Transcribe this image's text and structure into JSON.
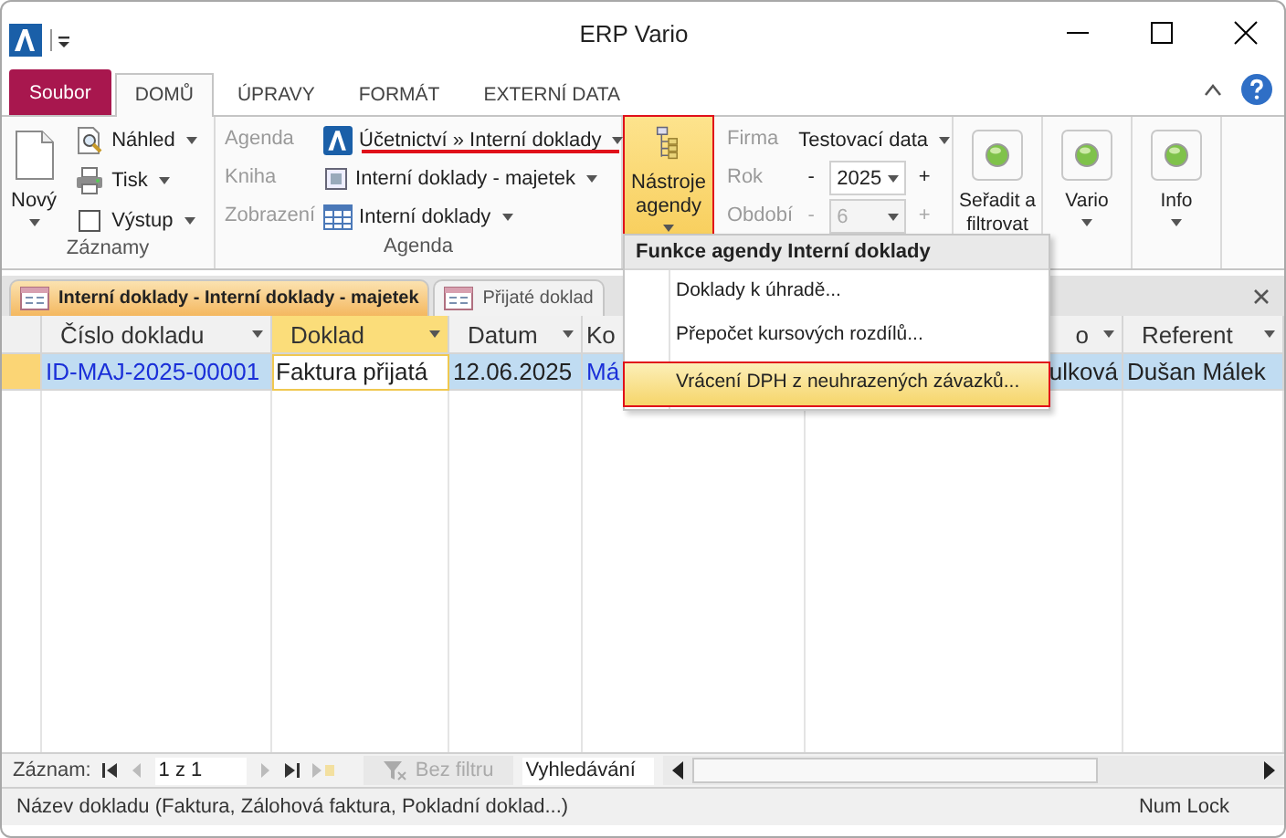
{
  "window": {
    "title": "ERP Vario"
  },
  "ribbon_tabs": [
    {
      "label": "Soubor",
      "kind": "file",
      "selected": false
    },
    {
      "label": "DOMŮ",
      "kind": "tab",
      "selected": true
    },
    {
      "label": "ÚPRAVY",
      "kind": "tab",
      "selected": false
    },
    {
      "label": "FORMÁT",
      "kind": "tab",
      "selected": false
    },
    {
      "label": "EXTERNÍ DATA",
      "kind": "tab",
      "selected": false
    }
  ],
  "records_group": {
    "label": "Záznamy",
    "new_button": "Nový",
    "items": [
      {
        "label": "Náhled",
        "kind": "preview"
      },
      {
        "label": "Tisk",
        "kind": "print"
      },
      {
        "label": "Výstup",
        "kind": "output"
      }
    ]
  },
  "agenda_group": {
    "label": "Agenda",
    "rows": [
      {
        "label": "Agenda",
        "value": "Účetnictví » Interní doklady",
        "kind": "agenda"
      },
      {
        "label": "Kniha",
        "value": "Interní doklady - majetek",
        "kind": "book"
      },
      {
        "label": "Zobrazení",
        "value": "Interní doklady",
        "kind": "view"
      }
    ]
  },
  "tools_button": {
    "label": "Nástroje agendy",
    "active": true,
    "highlighted": true
  },
  "period_group": {
    "company": {
      "label": "Firma",
      "value": "Testovací data"
    },
    "fields": [
      {
        "label": "Rok",
        "minus": "-",
        "value": "2025",
        "plus": "+",
        "disabled": false
      },
      {
        "label": "Období",
        "minus": "-",
        "value": "6",
        "plus": "+",
        "disabled": true
      }
    ]
  },
  "big_buttons": [
    {
      "label": "Seřadit a filtrovat"
    },
    {
      "label": "Vario"
    },
    {
      "label": "Info"
    }
  ],
  "document_tabs": [
    {
      "label": "Interní doklady - Interní doklady - majetek",
      "selected": true
    },
    {
      "label": "Přijaté doklad",
      "selected": false
    }
  ],
  "table": {
    "columns": [
      {
        "label": "Číslo dokladu",
        "selected": false
      },
      {
        "label": "Doklad",
        "selected": true
      },
      {
        "label": "Datum",
        "selected": false
      },
      {
        "label": "Ko",
        "selected": false
      },
      {
        "label": "o",
        "selected": false
      },
      {
        "label": "Referent",
        "selected": false
      }
    ],
    "rows": [
      {
        "selected": true,
        "cells": [
          {
            "text": "ID-MAJ-2025-00001",
            "kind": "link",
            "focused": false
          },
          {
            "text": "Faktura přijatá",
            "kind": "text",
            "focused": true
          },
          {
            "text": "12.06.2025",
            "kind": "text",
            "focused": false
          },
          {
            "text": "Má",
            "kind": "link",
            "focused": false
          },
          {
            "text": "ulková",
            "kind": "text",
            "focused": false
          },
          {
            "text": "Dušan Málek",
            "kind": "text",
            "focused": false
          }
        ]
      }
    ]
  },
  "menu": {
    "header": "Funkce agendy Interní doklady",
    "items": [
      {
        "label": "Doklady k úhradě...",
        "selected": false
      },
      {
        "label": "Přepočet kursových rozdílů...",
        "selected": false
      },
      {
        "label": "Vrácení DPH z neuhrazených závazků...",
        "selected": true
      }
    ]
  },
  "navigator": {
    "label": "Záznam:",
    "position": "1 z 1",
    "filter": {
      "label": "Bez filtru",
      "disabled": true
    },
    "search": {
      "placeholder": "Vyhledávání"
    }
  },
  "status_bar": {
    "text": "Název dokladu (Faktura, Zálohová faktura, Pokladní doklad...)",
    "indicator": "Num Lock"
  }
}
